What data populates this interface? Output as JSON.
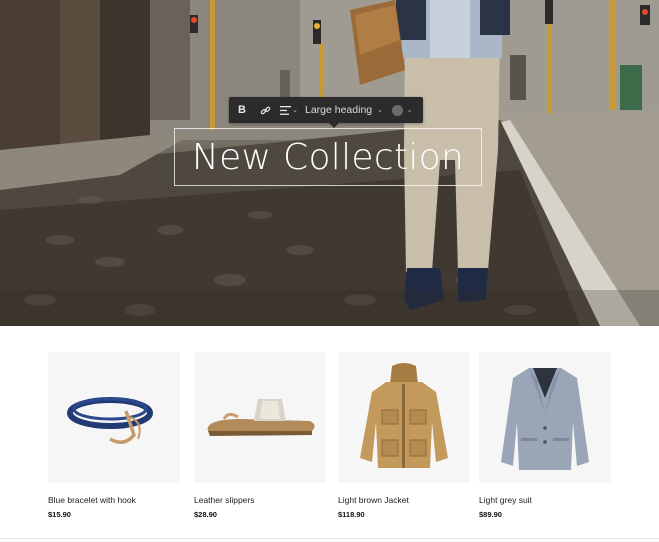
{
  "toolbar": {
    "bold_label": "B",
    "link_icon": "link-icon",
    "align_icon": "align-left-icon",
    "heading_style": "Large heading",
    "color_swatch": "#6b6b6b"
  },
  "hero": {
    "heading": "New Collection"
  },
  "products": [
    {
      "name": "Blue bracelet with hook",
      "price": "$15.90",
      "icon": "bracelet-image"
    },
    {
      "name": "Leather slippers",
      "price": "$28.90",
      "icon": "slippers-image"
    },
    {
      "name": "Light brown Jacket",
      "price": "$118.90",
      "icon": "jacket-image"
    },
    {
      "name": "Light grey suit",
      "price": "$89.90",
      "icon": "suit-image"
    }
  ]
}
